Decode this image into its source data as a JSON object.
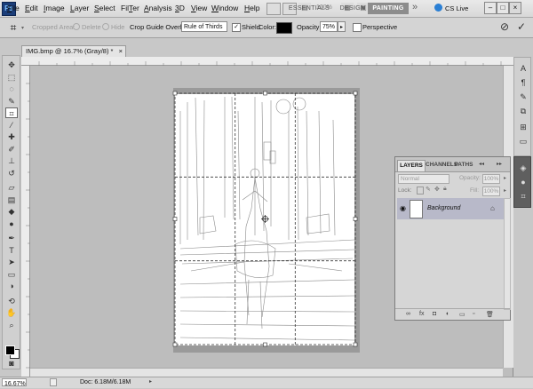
{
  "app": {
    "logo": "Ps",
    "menu": [
      {
        "label": "File",
        "u": "F",
        "rest": "ile"
      },
      {
        "label": "Edit",
        "u": "E",
        "rest": "dit"
      },
      {
        "label": "Image",
        "u": "I",
        "rest": "mage"
      },
      {
        "label": "Layer",
        "u": "L",
        "rest": "ayer"
      },
      {
        "label": "Select",
        "u": "S",
        "rest": "elect"
      },
      {
        "label": "Filter",
        "u": "T",
        "pre": "Fil",
        "rest": "er"
      },
      {
        "label": "Analysis",
        "u": "A",
        "rest": "nalysis"
      },
      {
        "label": "3D",
        "u": "3",
        "rest": "D"
      },
      {
        "label": "View",
        "u": "V",
        "rest": "iew"
      },
      {
        "label": "Window",
        "u": "W",
        "rest": "indow"
      },
      {
        "label": "Help",
        "u": "H",
        "rest": "elp"
      }
    ],
    "zoom": "100%",
    "workspaces": [
      "ESSENTIALS",
      "DESIGN",
      "PAINTING"
    ],
    "active_workspace": "PAINTING",
    "more": "»",
    "cs_live": "CS Live",
    "window_buttons": [
      "–",
      "□",
      "×"
    ]
  },
  "options": {
    "cropped_area_label": "Cropped Area:",
    "delete_label": "Delete",
    "hide_label": "Hide",
    "crop_guide_label": "Crop Guide Overlay:",
    "crop_guide_value": "Rule of Thirds",
    "shield_label": "Shield",
    "shield_checked": true,
    "color_label": "Color:",
    "shield_color": "#000000",
    "opacity_label": "Opacity:",
    "opacity_value": "75%",
    "perspective_label": "Perspective",
    "perspective_checked": false,
    "cancel_symbol": "⊘",
    "commit_symbol": "✓"
  },
  "document": {
    "tab_title": "IMG.bmp @ 16.7% (Gray/8) *",
    "close": "×"
  },
  "tools": [
    {
      "name": "move-tool-icon",
      "glyph": "✥"
    },
    {
      "name": "marquee-tool-icon",
      "glyph": "⬚"
    },
    {
      "name": "lasso-tool-icon",
      "glyph": "◌"
    },
    {
      "name": "quick-select-tool-icon",
      "glyph": "✎"
    },
    {
      "name": "crop-tool-icon",
      "glyph": "⌗",
      "selected": true
    },
    {
      "name": "eyedropper-tool-icon",
      "glyph": "⁄"
    },
    {
      "name": "healing-brush-tool-icon",
      "glyph": "✚"
    },
    {
      "name": "brush-tool-icon",
      "glyph": "✐"
    },
    {
      "name": "clone-stamp-tool-icon",
      "glyph": "⊥"
    },
    {
      "name": "history-brush-tool-icon",
      "glyph": "↺"
    },
    {
      "name": "eraser-tool-icon",
      "glyph": "▱"
    },
    {
      "name": "gradient-tool-icon",
      "glyph": "▤"
    },
    {
      "name": "blur-tool-icon",
      "glyph": "◆"
    },
    {
      "name": "dodge-tool-icon",
      "glyph": "●"
    },
    {
      "name": "pen-tool-icon",
      "glyph": "✒"
    },
    {
      "name": "type-tool-icon",
      "glyph": "T"
    },
    {
      "name": "path-select-tool-icon",
      "glyph": "➤"
    },
    {
      "name": "shape-tool-icon",
      "glyph": "▭"
    },
    {
      "name": "3d-rotate-tool-icon",
      "glyph": "◑"
    },
    {
      "name": "3d-camera-tool-icon",
      "glyph": "⟲"
    },
    {
      "name": "hand-tool-icon",
      "glyph": "✋"
    },
    {
      "name": "zoom-tool-icon",
      "glyph": "⌕"
    }
  ],
  "status": {
    "zoom": "16.67%",
    "doc_info": "Doc: 6.18M/6.18M"
  },
  "layers_panel": {
    "tabs": [
      "LAYERS",
      "CHANNELS",
      "PATHS"
    ],
    "active_tab": "LAYERS",
    "blend_mode": "Normal",
    "opacity_label": "Opacity:",
    "opacity_value": "100%",
    "lock_label": "Lock:",
    "fill_label": "Fill:",
    "fill_value": "100%",
    "menu_symbol": "▸▸",
    "layers": [
      {
        "name": "Background",
        "visible": true,
        "locked": true
      }
    ],
    "footer_icons": [
      "link-layers-icon",
      "fx-icon",
      "mask-icon",
      "adjustment-icon",
      "group-icon",
      "new-layer-icon",
      "trash-icon"
    ]
  },
  "dock": {
    "icons": [
      "character-icon",
      "paragraph-icon",
      "brushes-icon",
      "clone-source-icon",
      "tool-presets-icon",
      "tool-presets-2-icon"
    ],
    "dark_icons": [
      "layers-icon",
      "channels-icon",
      "paths-icon"
    ]
  }
}
